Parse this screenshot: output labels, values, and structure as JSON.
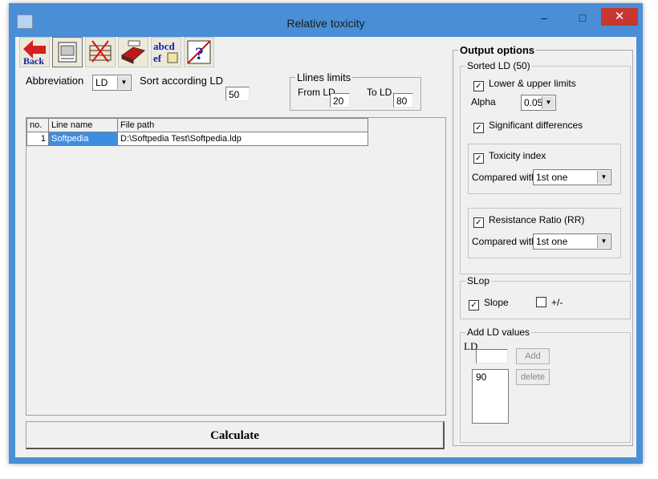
{
  "window": {
    "title": "Relative toxicity"
  },
  "titlebar": {
    "minimize": "–",
    "maximize": "□",
    "close": "✕"
  },
  "toolbar": {
    "back_label": "Back",
    "tools": [
      "back-icon",
      "report-icon",
      "delete-rows-icon",
      "eraser-icon",
      "abbreviations-icon",
      "help-icon"
    ],
    "abcd_text": "abcd"
  },
  "top": {
    "abbreviation_label": "Abbreviation",
    "abbreviation_value": "LD",
    "sort_label": "Sort according LD",
    "sort_value": "50"
  },
  "limits": {
    "title": "Llines limits",
    "from_label": "From LD",
    "from_value": "20",
    "to_label": "To LD",
    "to_value": "80"
  },
  "grid": {
    "columns": [
      "no.",
      "Line name",
      "File path"
    ],
    "rows": [
      {
        "no": "1",
        "name": "Softpedia",
        "path": "D:\\Softpedia Test\\Softpedia.ldp"
      }
    ]
  },
  "calculate_label": "Calculate",
  "output": {
    "title": "Output options",
    "sorted": {
      "title": "Sorted LD (50)",
      "lower_upper_label": "Lower & upper limits",
      "alpha_label": "Alpha",
      "alpha_value": "0.05",
      "significant_label": "Significant differences",
      "toxicity_label": "Toxicity index",
      "toxicity_compared_label": "Compared with",
      "toxicity_compared_value": "1st one",
      "rr_label": "Resistance Ratio (RR)",
      "rr_compared_label": "Compared with",
      "rr_compared_value": "1st one"
    },
    "slop": {
      "title": "SLop",
      "slope_label": "Slope",
      "plusminus_label": "+/-"
    },
    "add_ld": {
      "title": "Add LD values",
      "ld_label": "LD",
      "ld_value": "",
      "add_label": "Add",
      "delete_label": "delete",
      "values": [
        "90"
      ]
    }
  },
  "check_mark": "✓",
  "colors": {
    "frame": "#4a8fd6",
    "close": "#c7372f",
    "selection": "#3d8ee0"
  }
}
